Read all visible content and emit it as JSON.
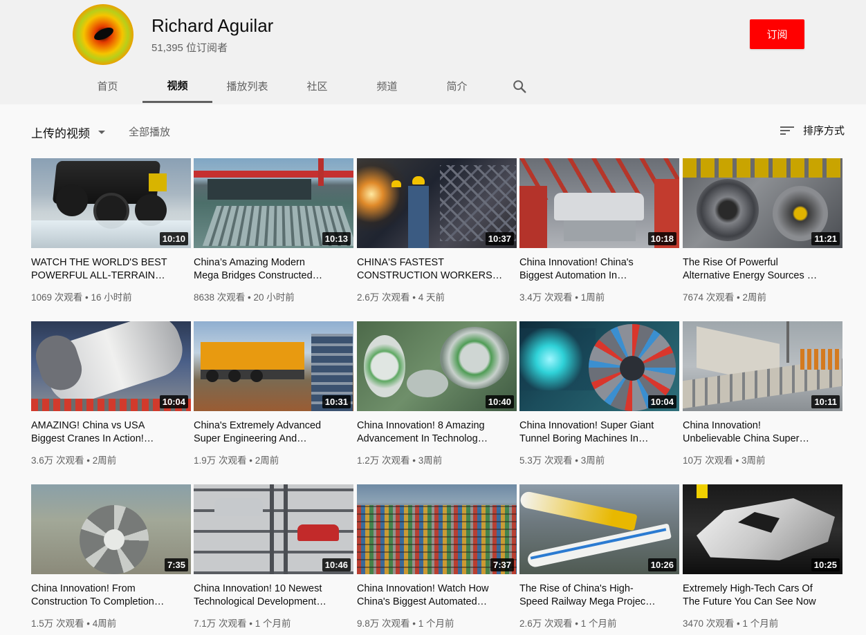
{
  "channel": {
    "name": "Richard Aguilar",
    "subscribers": "51,395 位订阅者",
    "subscribe_label": "订阅"
  },
  "tabs": [
    {
      "label": "首页"
    },
    {
      "label": "视频",
      "active": true
    },
    {
      "label": "播放列表"
    },
    {
      "label": "社区"
    },
    {
      "label": "频道"
    },
    {
      "label": "简介"
    }
  ],
  "search_icon": "search-icon",
  "toolbar": {
    "uploads_label": "上传的视频",
    "play_all_label": "全部播放",
    "sort_label": "排序方式"
  },
  "videos": [
    {
      "title1": "WATCH THE WORLD'S BEST",
      "title2": "POWERFUL ALL-TERRAIN…",
      "duration": "10:10",
      "meta": "1069 次观看 • 16 小时前"
    },
    {
      "title1": "China’s Amazing Modern",
      "title2": "Mega Bridges Constructed…",
      "duration": "10:13",
      "meta": "8638 次观看 • 20 小时前"
    },
    {
      "title1": "CHINA'S FASTEST",
      "title2": "CONSTRUCTION WORKERS…",
      "duration": "10:37",
      "meta": "2.6万 次观看 • 4 天前"
    },
    {
      "title1": "China Innovation! China's",
      "title2": "Biggest Automation In…",
      "duration": "10:18",
      "meta": "3.4万 次观看 • 1周前"
    },
    {
      "title1": "The Rise Of Powerful",
      "title2": "Alternative Energy Sources …",
      "duration": "11:21",
      "meta": "7674 次观看 • 2周前"
    },
    {
      "title1": "AMAZING! China vs USA",
      "title2": "Biggest Cranes In Action!…",
      "duration": "10:04",
      "meta": "3.6万 次观看 • 2周前"
    },
    {
      "title1": "China's Extremely Advanced",
      "title2": "Super Engineering And…",
      "duration": "10:31",
      "meta": "1.9万 次观看 • 2周前"
    },
    {
      "title1": "China Innovation! 8 Amazing",
      "title2": "Advancement In Technolog…",
      "duration": "10:40",
      "meta": "1.2万 次观看 • 3周前"
    },
    {
      "title1": "China Innovation! Super Giant",
      "title2": "Tunnel Boring Machines In…",
      "duration": "10:04",
      "meta": "5.3万 次观看 • 3周前"
    },
    {
      "title1": "China Innovation!",
      "title2": "Unbelievable China Super…",
      "duration": "10:11",
      "meta": "10万 次观看 • 3周前"
    },
    {
      "title1": "China Innovation! From",
      "title2": "Construction To Completion…",
      "duration": "7:35",
      "meta": "1.5万 次观看 • 4周前"
    },
    {
      "title1": "China Innovation! 10 Newest",
      "title2": "Technological Development…",
      "duration": "10:46",
      "meta": "7.1万 次观看 • 1 个月前"
    },
    {
      "title1": "China Innovation! Watch How",
      "title2": "China's Biggest Automated…",
      "duration": "7:37",
      "meta": "9.8万 次观看 • 1 个月前"
    },
    {
      "title1": "The Rise of China's High-",
      "title2": "Speed Railway Mega Projec…",
      "duration": "10:26",
      "meta": "2.6万 次观看 • 1 个月前"
    },
    {
      "title1": "Extremely High-Tech Cars Of",
      "title2": "The Future You Can See Now",
      "duration": "10:25",
      "meta": "3470 次观看 • 1 个月前"
    }
  ],
  "colors": {
    "accent": "#ff0000",
    "header_bg": "#f1f1f1",
    "page_bg": "#f9f9f9",
    "secondary_text": "#606060"
  }
}
